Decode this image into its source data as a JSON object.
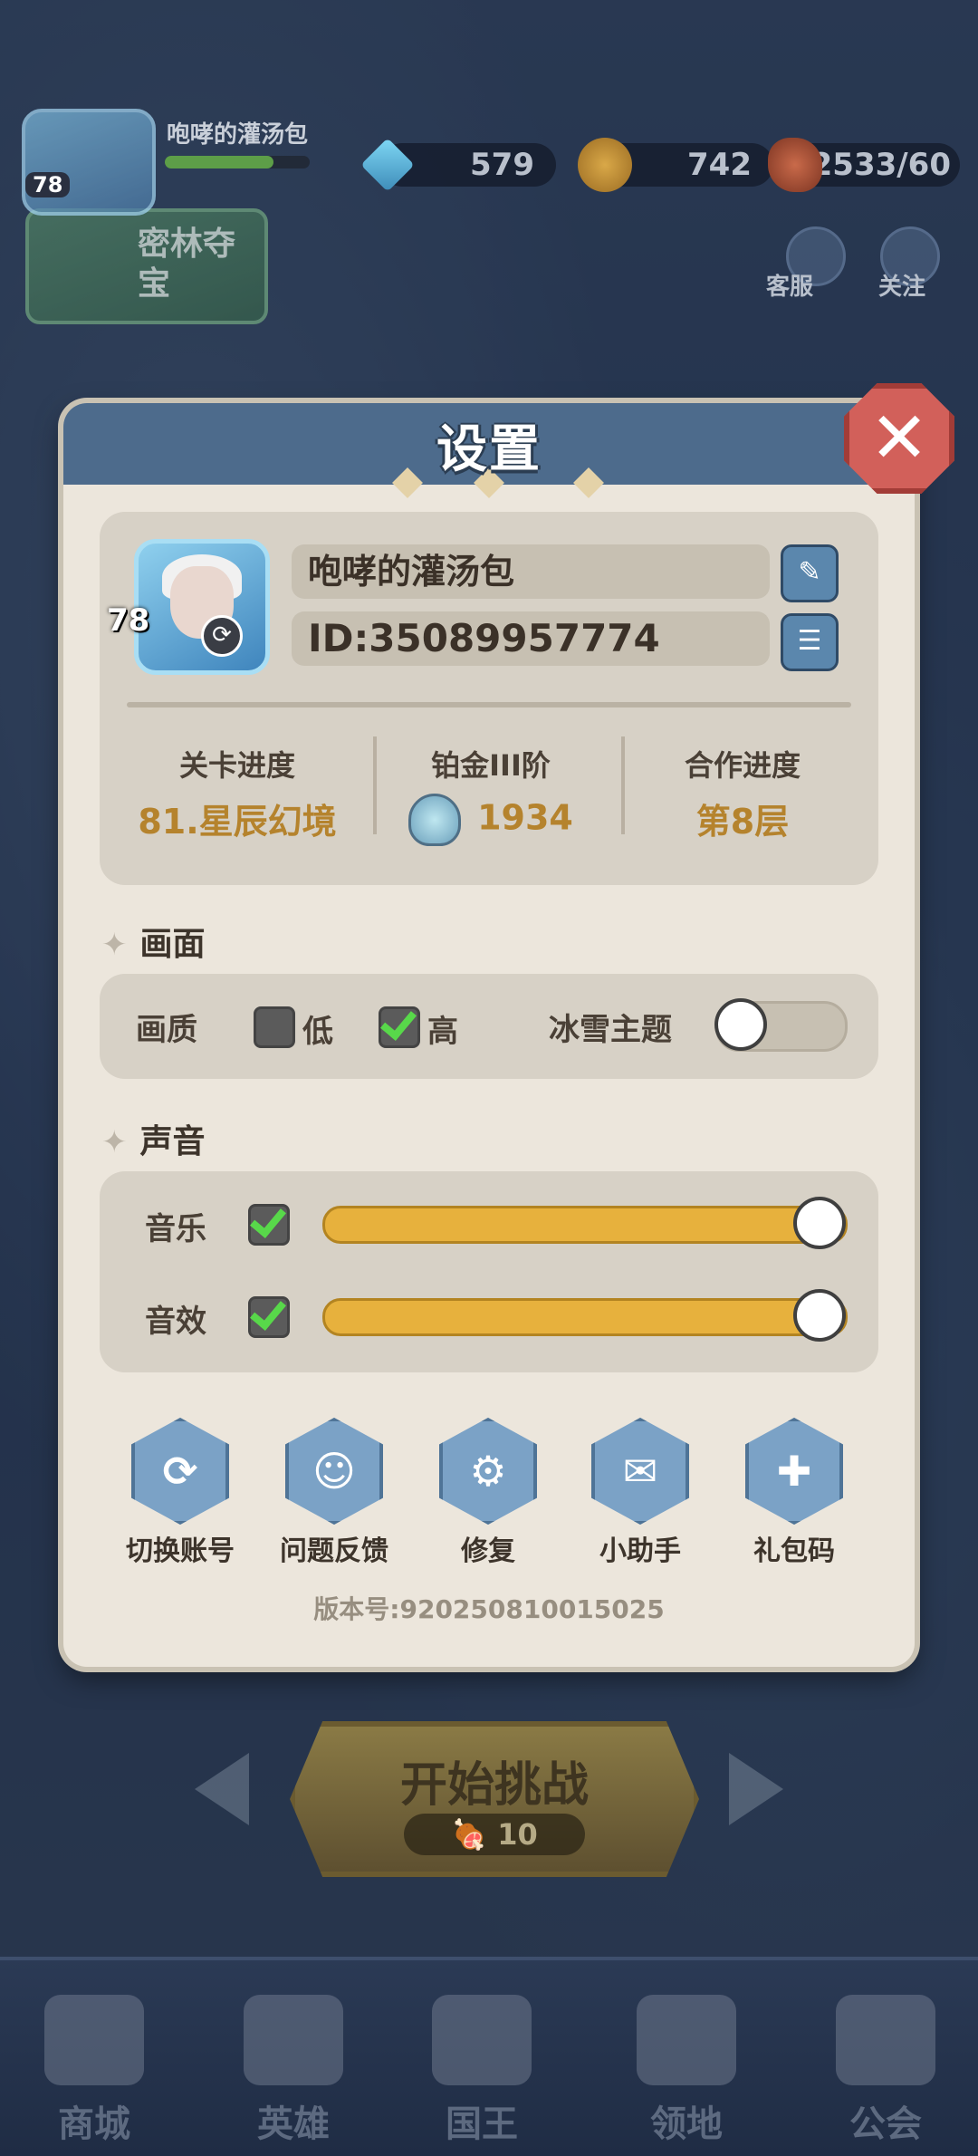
{
  "hud": {
    "player_name": "咆哮的灌汤包",
    "level": "78",
    "gems": "579",
    "coins": "742",
    "stamina": "2533/60",
    "event_label": "密林夺宝",
    "customer_service": "客服",
    "follow": "关注"
  },
  "settings": {
    "title": "设置",
    "profile": {
      "name": "咆哮的灌汤包",
      "id": "ID:35089957774",
      "level": "78"
    },
    "stats": [
      {
        "label": "关卡进度",
        "value": "81.星辰幻境"
      },
      {
        "label": "铂金III阶",
        "value": "1934"
      },
      {
        "label": "合作进度",
        "value": "第8层"
      }
    ],
    "display": {
      "heading": "画面",
      "quality_label": "画质",
      "low_label": "低",
      "high_label": "高",
      "low_checked": false,
      "high_checked": true,
      "snow_theme_label": "冰雪主题",
      "snow_theme_on": false
    },
    "sound": {
      "heading": "声音",
      "music_label": "音乐",
      "music_enabled": true,
      "music_volume": 1.0,
      "sfx_label": "音效",
      "sfx_enabled": true,
      "sfx_volume": 1.0
    },
    "actions": [
      {
        "label": "切换账号",
        "icon": "refresh-icon"
      },
      {
        "label": "问题反馈",
        "icon": "feedback-icon"
      },
      {
        "label": "修复",
        "icon": "gear-wrench-icon"
      },
      {
        "label": "小助手",
        "icon": "chat-bubble-icon"
      },
      {
        "label": "礼包码",
        "icon": "gift-icon"
      }
    ],
    "version": "版本号:920250810015025"
  },
  "game": {
    "start_button": "开始挑战",
    "start_cost": "10"
  },
  "nav": [
    {
      "label": "商城"
    },
    {
      "label": "英雄"
    },
    {
      "label": "国王"
    },
    {
      "label": "领地"
    },
    {
      "label": "公会"
    }
  ]
}
